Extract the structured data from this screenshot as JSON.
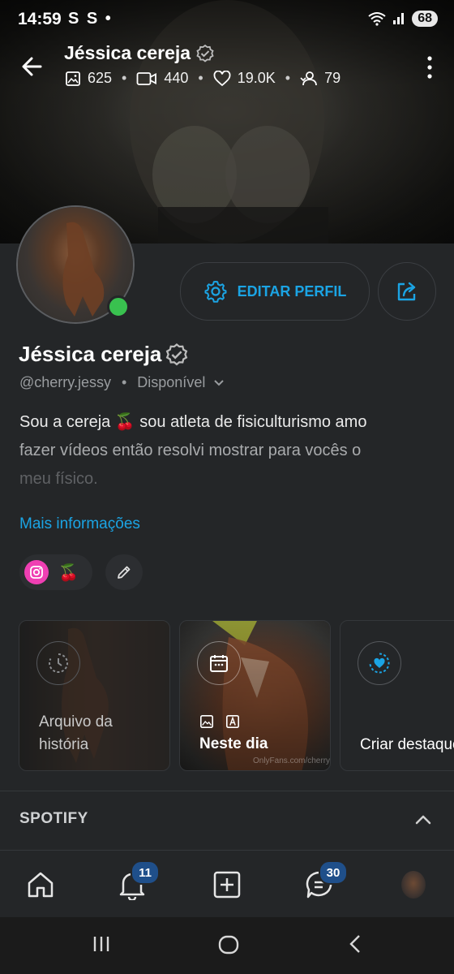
{
  "status_bar": {
    "time": "14:59",
    "left_icons": "S S •",
    "battery": "68"
  },
  "header": {
    "name": "Jéssica cereja",
    "stats": {
      "photos": "625",
      "videos": "440",
      "likes": "19.0K",
      "fans": "79"
    }
  },
  "actions": {
    "edit_profile": "EDITAR PERFIL"
  },
  "profile": {
    "name": "Jéssica cereja",
    "handle": "@cherry.jessy",
    "availability": "Disponível",
    "bio_line1": "Sou a cereja 🍒 sou atleta de fisiculturismo amo",
    "bio_line2": "fazer vídeos então resolvi mostrar para vocês o",
    "bio_line3": "meu físico.",
    "more_info": "Mais informações",
    "social_emoji": "🍒"
  },
  "highlights": [
    {
      "title_line1": "Arquivo da",
      "title_line2": "história"
    },
    {
      "title": "Neste dia",
      "watermark": "OnlyFans.com/cherry.jessy"
    },
    {
      "title": "Criar destaque"
    }
  ],
  "spotify": {
    "label": "SPOTIFY"
  },
  "bottom_nav": {
    "notifications_badge": "11",
    "messages_badge": "30"
  },
  "colors": {
    "accent": "#1ba4e4",
    "background": "#242628",
    "online": "#39c14f",
    "instagram": "#ef3fb3",
    "badge": "#1f4f8a"
  }
}
